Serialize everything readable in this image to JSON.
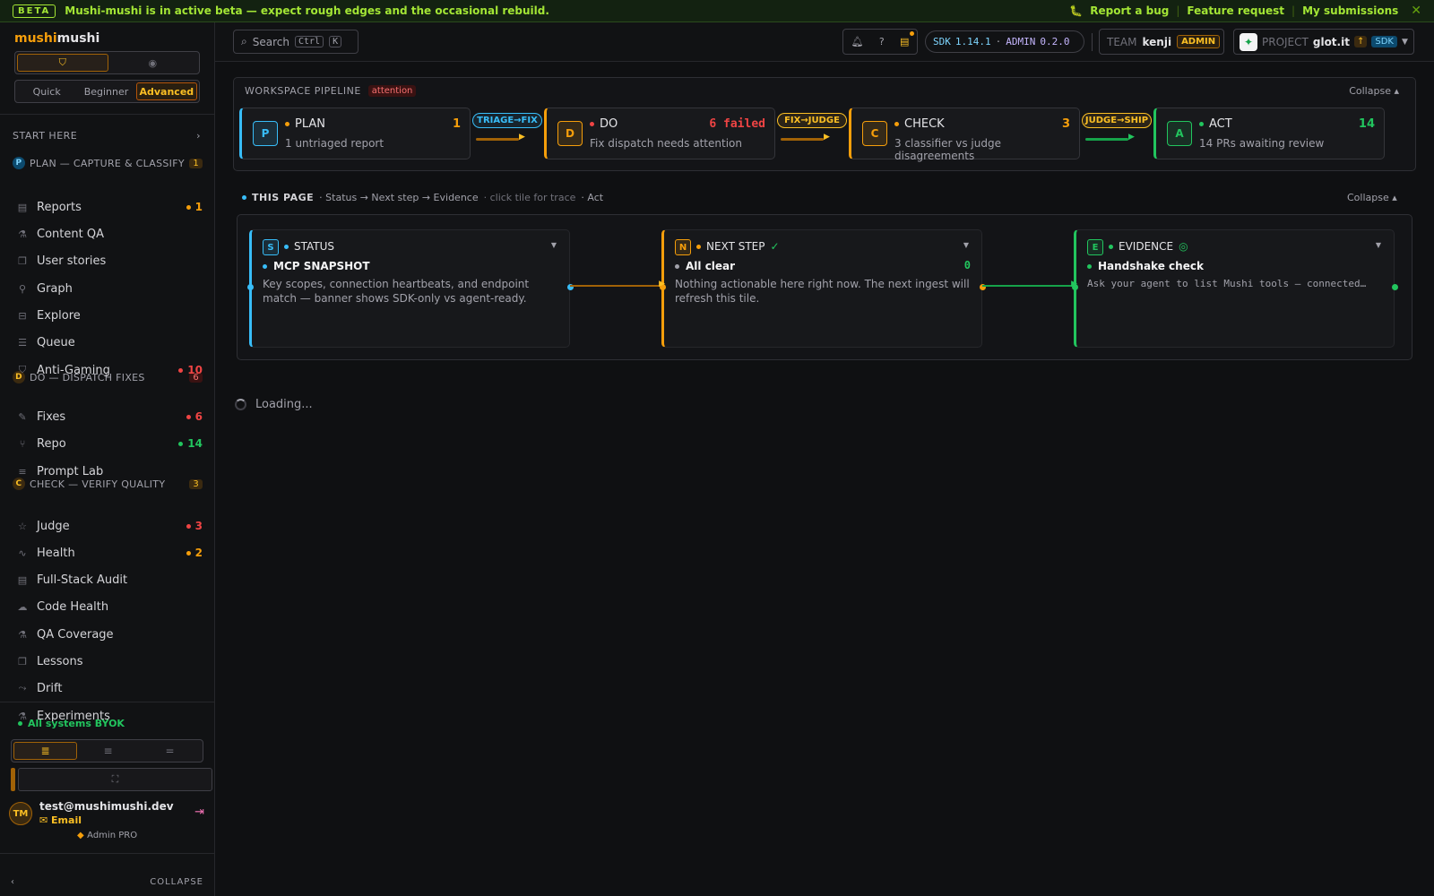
{
  "banner": {
    "badge": "BETA",
    "message": "Mushi-mushi is in active beta — expect rough edges and the occasional rebuild.",
    "report_bug": "Report a bug",
    "feature_request": "Feature request",
    "my_submissions": "My submissions",
    "close_glyph": "✕",
    "bug_icon": "bug-icon",
    "accent": "#a3e635"
  },
  "sidebar": {
    "brand_a": "mushi",
    "brand_b": "mushi",
    "levels": [
      "Quick",
      "Beginner",
      "Advanced"
    ],
    "active_level": "Advanced",
    "start_here": "START HERE",
    "groups": [
      {
        "letter": "P",
        "title": "PLAN — CAPTURE & CLASSIFY",
        "count": "1",
        "color": "#38bdf8"
      },
      {
        "letter": "D",
        "title": "DO — DISPATCH FIXES",
        "count": "6",
        "color": "#f59e0b"
      },
      {
        "letter": "C",
        "title": "CHECK — VERIFY QUALITY",
        "count": "3",
        "color": "#f59e0b"
      }
    ],
    "items": [
      {
        "label": "Reports",
        "icon": "document-icon",
        "badge": "1",
        "badge_color": "#f59e0b"
      },
      {
        "label": "Content QA",
        "icon": "beaker-icon",
        "badge": "",
        "badge_color": ""
      },
      {
        "label": "User stories",
        "icon": "book-icon",
        "badge": "",
        "badge_color": ""
      },
      {
        "label": "Graph",
        "icon": "graph-icon",
        "badge": "",
        "badge_color": ""
      },
      {
        "label": "Explore",
        "icon": "explore-icon",
        "badge": "",
        "badge_color": ""
      },
      {
        "label": "Queue",
        "icon": "queue-icon",
        "badge": "",
        "badge_color": ""
      },
      {
        "label": "Anti-Gaming",
        "icon": "shield-icon",
        "badge": "10",
        "badge_color": "#ef4444"
      },
      {
        "label": "Fixes",
        "icon": "wrench-icon",
        "badge": "6",
        "badge_color": "#ef4444"
      },
      {
        "label": "Repo",
        "icon": "branch-icon",
        "badge": "14",
        "badge_color": "#22c55e"
      },
      {
        "label": "Prompt Lab",
        "icon": "lines-icon",
        "badge": "",
        "badge_color": ""
      },
      {
        "label": "Judge",
        "icon": "star-icon",
        "badge": "3",
        "badge_color": "#ef4444"
      },
      {
        "label": "Health",
        "icon": "pulse-icon",
        "badge": "2",
        "badge_color": "#f59e0b"
      },
      {
        "label": "Full-Stack Audit",
        "icon": "document-icon",
        "badge": "",
        "badge_color": ""
      },
      {
        "label": "Code Health",
        "icon": "cloud-icon",
        "badge": "",
        "badge_color": ""
      },
      {
        "label": "QA Coverage",
        "icon": "beaker-icon",
        "badge": "",
        "badge_color": ""
      },
      {
        "label": "Lessons",
        "icon": "book-icon",
        "badge": "",
        "badge_color": ""
      },
      {
        "label": "Drift",
        "icon": "drift-icon",
        "badge": "",
        "badge_color": ""
      },
      {
        "label": "Experiments",
        "icon": "flask-icon",
        "badge": "",
        "badge_color": ""
      }
    ],
    "status": "All systems BYOK",
    "user": {
      "initials": "TM",
      "email": "test@mushimushi.dev",
      "method": "Email",
      "plan": "Admin PRO"
    },
    "collapse": "COLLAPSE"
  },
  "topbar": {
    "search_label": "Search",
    "shortcut_a": "Ctrl",
    "shortcut_b": "K",
    "sdk_label": "SDK",
    "sdk_version": "1.14.1",
    "admin_label": "ADMIN",
    "admin_version": "0.2.0",
    "team_label": "TEAM",
    "team_name": "kenji",
    "team_role": "ADMIN",
    "project_label": "PROJECT",
    "project_name": "glot.it",
    "project_sdk": "SDK"
  },
  "pipeline": {
    "title": "WORKSPACE PIPELINE",
    "status": "attention",
    "collapse": "Collapse",
    "stages": [
      {
        "letter": "P",
        "name": "PLAN",
        "count": "1",
        "desc": "1 untriaged report",
        "color": "#38bdf8",
        "dot": "#f59e0b",
        "count_color": "#f59e0b"
      },
      {
        "letter": "D",
        "name": "DO",
        "count": "6 failed",
        "desc": "Fix dispatch needs attention",
        "color": "#f59e0b",
        "dot": "#ef4444",
        "count_color": "#ef4444"
      },
      {
        "letter": "C",
        "name": "CHECK",
        "count": "3",
        "desc": "3 classifier vs judge disagreements",
        "color": "#f59e0b",
        "dot": "#f59e0b",
        "count_color": "#f59e0b"
      },
      {
        "letter": "A",
        "name": "ACT",
        "count": "14",
        "desc": "14 PRs awaiting review",
        "color": "#22c55e",
        "dot": "#22c55e",
        "count_color": "#22c55e"
      }
    ],
    "connectors": [
      {
        "label": "TRIAGE→FIX",
        "color": "#38bdf8",
        "line": "#a16207"
      },
      {
        "label": "FIX→JUDGE",
        "color": "#fbbf24",
        "line": "#a16207"
      },
      {
        "label": "JUDGE→SHIP",
        "color": "#fbbf24",
        "line": "#16a34a"
      }
    ]
  },
  "this_page": {
    "title": "THIS PAGE",
    "crumb": "· Status → Next step → Evidence",
    "hint": "· click tile for trace",
    "act": "·  Act",
    "collapse": "Collapse",
    "tiles": [
      {
        "letter": "S",
        "name": "STATUS",
        "check": "",
        "sub": "MCP SNAPSHOT",
        "num": "",
        "body": "Key scopes, connection heartbeats, and endpoint match — banner shows SDK-only vs agent-ready.",
        "color": "#38bdf8",
        "mono": false
      },
      {
        "letter": "N",
        "name": "NEXT STEP",
        "check": "✓",
        "sub": "All clear",
        "num": "0",
        "body": "Nothing actionable here right now. The next ingest will refresh this tile.",
        "color": "#f59e0b",
        "mono": false
      },
      {
        "letter": "E",
        "name": "EVIDENCE",
        "check": "◎",
        "sub": "Handshake check",
        "num": "",
        "body": "Ask your agent to list Mushi tools — connected…",
        "color": "#22c55e",
        "mono": true
      }
    ]
  },
  "loading": "Loading..."
}
